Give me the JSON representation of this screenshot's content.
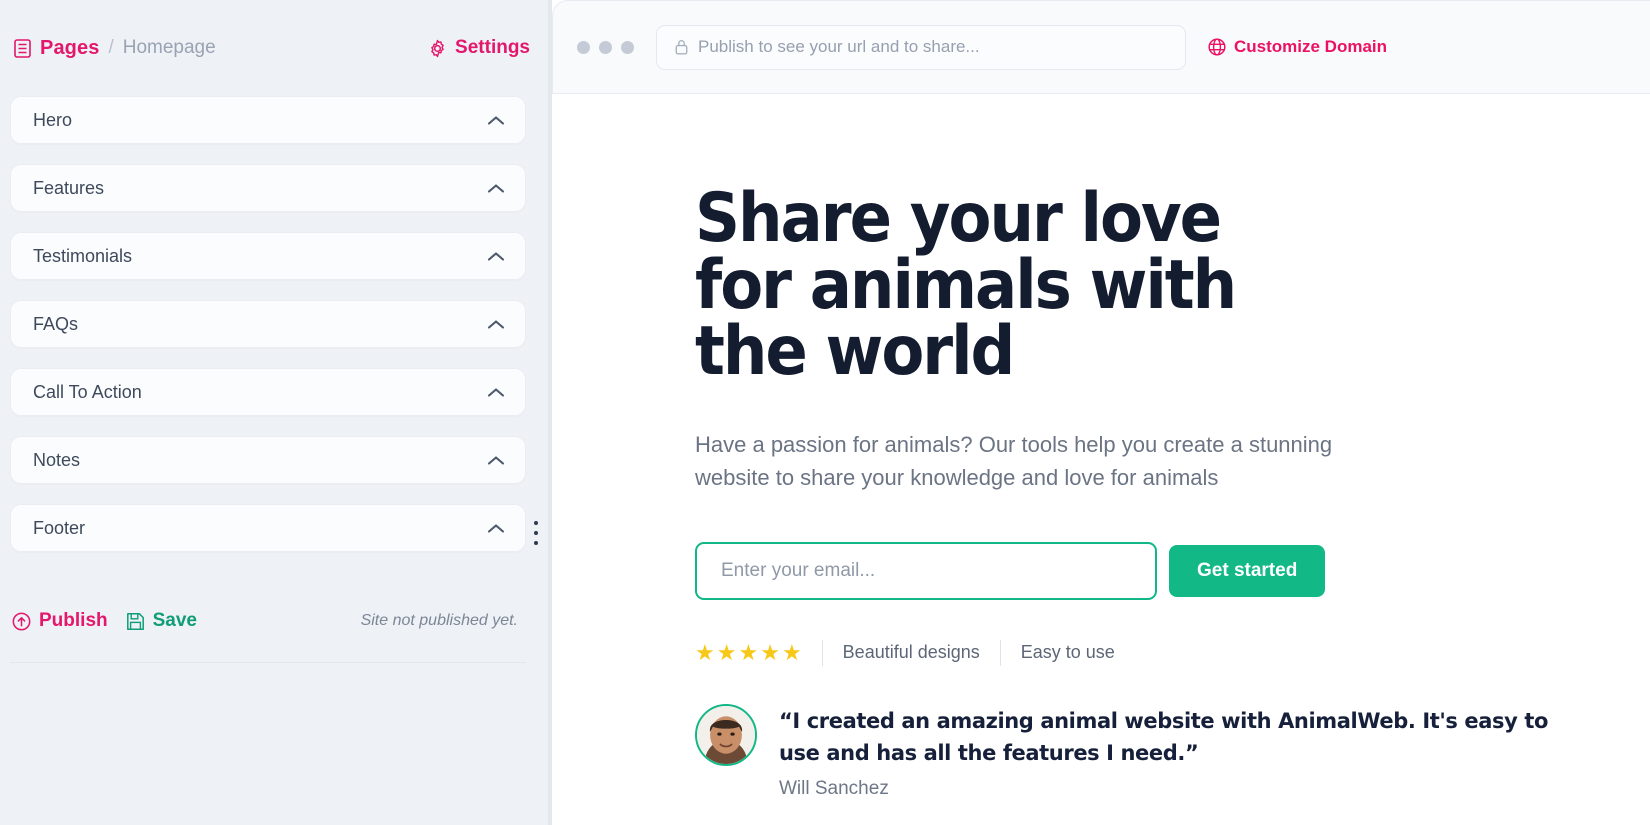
{
  "editor": {
    "breadcrumb": {
      "icon": "document-icon",
      "root": "Pages",
      "separator": "/",
      "current": "Homepage"
    },
    "settings_label": "Settings",
    "settings_icon": "gear-icon",
    "sections": [
      {
        "label": "Hero",
        "chevron": "chevron-up-icon"
      },
      {
        "label": "Features",
        "chevron": "chevron-up-icon"
      },
      {
        "label": "Testimonials",
        "chevron": "chevron-up-icon"
      },
      {
        "label": "FAQs",
        "chevron": "chevron-up-icon"
      },
      {
        "label": "Call To Action",
        "chevron": "chevron-up-icon"
      },
      {
        "label": "Notes",
        "chevron": "chevron-up-icon"
      },
      {
        "label": "Footer",
        "chevron": "chevron-up-icon"
      }
    ],
    "kebab_icon": "more-vertical-icon",
    "publish_label": "Publish",
    "publish_icon": "upload-circle-icon",
    "save_label": "Save",
    "save_icon": "floppy-disk-icon",
    "status_note": "Site not published yet."
  },
  "preview": {
    "browser": {
      "dots": 3,
      "lock_icon": "lock-icon",
      "url_placeholder": "Publish to see your url and to share...",
      "url_value": "",
      "customize_domain_label": "Customize Domain",
      "globe_icon": "globe-icon"
    },
    "hero": {
      "title": "Share your love for animals with the world",
      "subtitle": "Have a passion for animals? Our tools help you create a stunning website to share your knowledge and love for animals",
      "email_placeholder": "Enter your email...",
      "email_value": "",
      "cta_label": "Get started",
      "rating_stars": 5,
      "star_glyph": "★",
      "proof_items": [
        "Beautiful designs",
        "Easy to use"
      ]
    },
    "testimonial": {
      "avatar_alt": "avatar",
      "quote": "“I created an amazing animal website with AnimalWeb. It's easy to use and has all the features I need.”",
      "author": "Will Sanchez"
    }
  },
  "colors": {
    "brand_pink": "#e3176b",
    "brand_green": "#13b887",
    "star_gold": "#f8c818",
    "heading_navy": "#141d30",
    "panel_bg": "#eef1f6"
  }
}
